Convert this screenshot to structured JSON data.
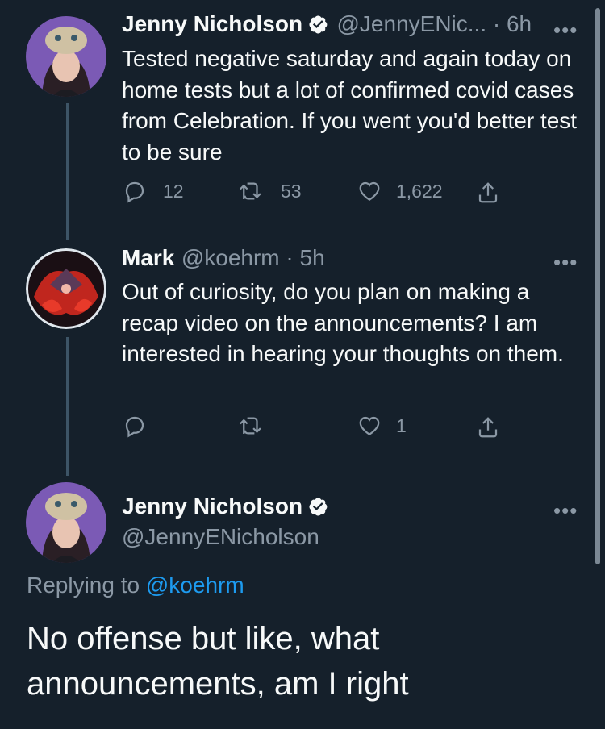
{
  "colors": {
    "background": "#15202b",
    "text": "#f7f9f9",
    "muted": "#8b98a5",
    "accent": "#1d9bf0"
  },
  "tweet1": {
    "name": "Jenny Nicholson",
    "handle_time": "@JennyENic... · 6h",
    "text": "Tested negative saturday and again today on home tests but a lot of confirmed covid cases from Celebration. If you went you'd better test to be sure",
    "replies": "12",
    "retweets": "53",
    "likes": "1,622"
  },
  "tweet2": {
    "name": "Mark",
    "handle_time": "@koehrm · 5h",
    "text": "Out of curiosity, do you plan on making a recap video on the announcements? I am interested in hearing your thoughts on them.",
    "replies": "",
    "retweets": "",
    "likes": "1"
  },
  "tweet3": {
    "name": "Jenny Nicholson",
    "handle": "@JennyENicholson",
    "replying_prefix": "Replying to ",
    "replying_handle": "@koehrm",
    "text": "No offense but like, what announcements, am I right"
  },
  "icons": {
    "more": "more-dots-icon",
    "reply": "reply-icon",
    "retweet": "retweet-icon",
    "like": "heart-icon",
    "share": "share-icon",
    "verified": "verified-badge-icon"
  },
  "more_glyph": "•••"
}
